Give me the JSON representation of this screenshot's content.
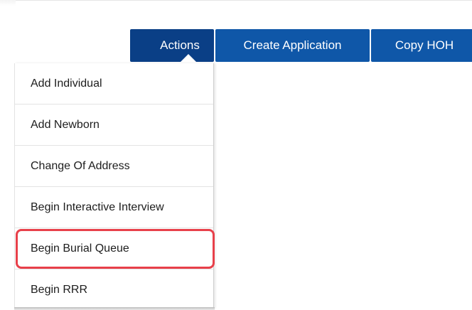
{
  "toolbar": {
    "actions_label": "Actions",
    "create_application_label": "Create Application",
    "copy_hoh_label": "Copy HOH"
  },
  "actions_menu": {
    "items": [
      {
        "label": "Add Individual"
      },
      {
        "label": "Add Newborn"
      },
      {
        "label": "Change Of Address"
      },
      {
        "label": "Begin Interactive Interview"
      },
      {
        "label": "Begin Burial Queue"
      },
      {
        "label": "Begin RRR"
      }
    ],
    "highlighted_item": "Begin Burial Queue",
    "highlight_color": "#e8404a"
  },
  "colors": {
    "button_primary": "#0f57a8",
    "button_active": "#0a3f86"
  }
}
